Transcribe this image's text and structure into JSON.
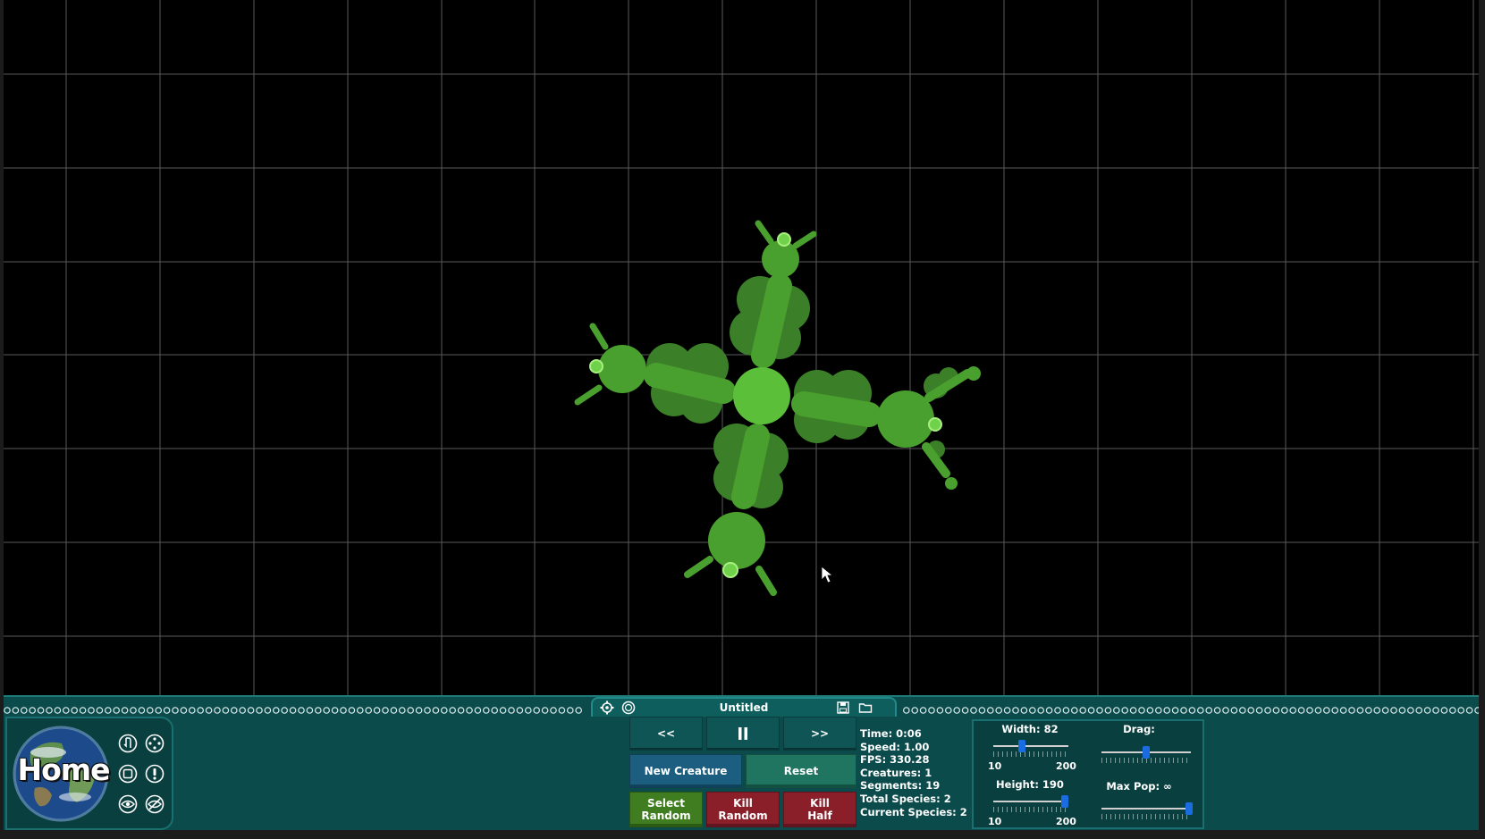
{
  "file": {
    "title": "Untitled"
  },
  "home": {
    "label": "Home"
  },
  "controls": {
    "rewind_label": "<<",
    "pause_label": "II",
    "forward_label": ">>",
    "new_creature_label": "New Creature",
    "reset_label": "Reset",
    "select_random_label": "Select\nRandom",
    "kill_random_label": "Kill\nRandom",
    "kill_half_label": "Kill\nHalf"
  },
  "stats": {
    "time": "Time: 0:06",
    "speed": "Speed: 1.00",
    "fps": "FPS: 330.28",
    "creatures": "Creatures: 1",
    "segments": "Segments: 19",
    "total_species": "Total Species: 2",
    "current_species": "Current Species: 2"
  },
  "settings": {
    "width_label": "Width: 82",
    "width_value": 82,
    "width_min": "10",
    "width_max": "200",
    "height_label": "Height: 190",
    "height_value": 190,
    "height_min": "10",
    "height_max": "200",
    "drag_label": "Drag:",
    "drag_fraction": 0.5,
    "maxpop_label": "Max Pop: ∞",
    "maxpop_fraction": 1.0
  },
  "colors": {
    "grid": "#5a5a5a",
    "creature_core": "#5bbf3a",
    "creature_mid": "#4aa02e",
    "creature_dark": "#3b7f28",
    "panel": "#0c4b4c",
    "slider_thumb": "#1a6de0"
  }
}
